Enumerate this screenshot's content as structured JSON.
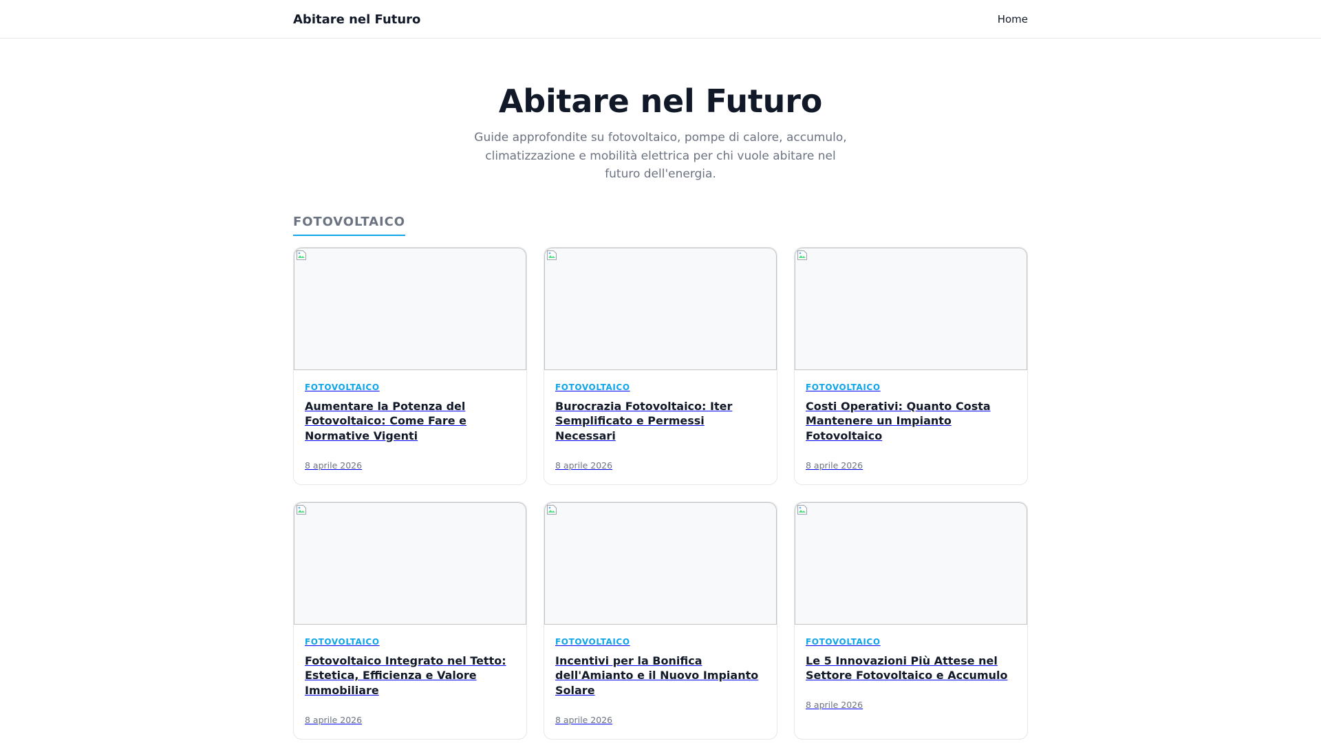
{
  "header": {
    "brand": "Abitare nel Futuro",
    "nav": [
      {
        "label": "Home"
      }
    ]
  },
  "hero": {
    "title": "Abitare nel Futuro",
    "subtitle": "Guide approfondite su fotovoltaico, pompe di calore, accumulo, climatizzazione e mobilità elettrica per chi vuole abitare nel futuro dell'energia."
  },
  "section": {
    "title": "FOTOVOLTAICO"
  },
  "colors": {
    "accent": "#0ea5e9",
    "text": "#111827",
    "muted": "#6b7280",
    "border": "#e5e7eb"
  },
  "cards": [
    {
      "category": "FOTOVOLTAICO",
      "title": "Aumentare la Potenza del Fotovoltaico: Come Fare e Normative Vigenti",
      "date": "8 aprile 2026",
      "image_icon": "broken-image-icon"
    },
    {
      "category": "FOTOVOLTAICO",
      "title": "Burocrazia Fotovoltaico: Iter Semplificato e Permessi Necessari",
      "date": "8 aprile 2026",
      "image_icon": "broken-image-icon"
    },
    {
      "category": "FOTOVOLTAICO",
      "title": "Costi Operativi: Quanto Costa Mantenere un Impianto Fotovoltaico",
      "date": "8 aprile 2026",
      "image_icon": "broken-image-icon"
    },
    {
      "category": "FOTOVOLTAICO",
      "title": "Fotovoltaico Integrato nel Tetto: Estetica, Efficienza e Valore Immobiliare",
      "date": "8 aprile 2026",
      "image_icon": "broken-image-icon"
    },
    {
      "category": "FOTOVOLTAICO",
      "title": "Incentivi per la Bonifica dell'Amianto e il Nuovo Impianto Solare",
      "date": "8 aprile 2026",
      "image_icon": "broken-image-icon"
    },
    {
      "category": "FOTOVOLTAICO",
      "title": "Le 5 Innovazioni Più Attese nel Settore Fotovoltaico e Accumulo",
      "date": "8 aprile 2026",
      "image_icon": "broken-image-icon"
    }
  ]
}
